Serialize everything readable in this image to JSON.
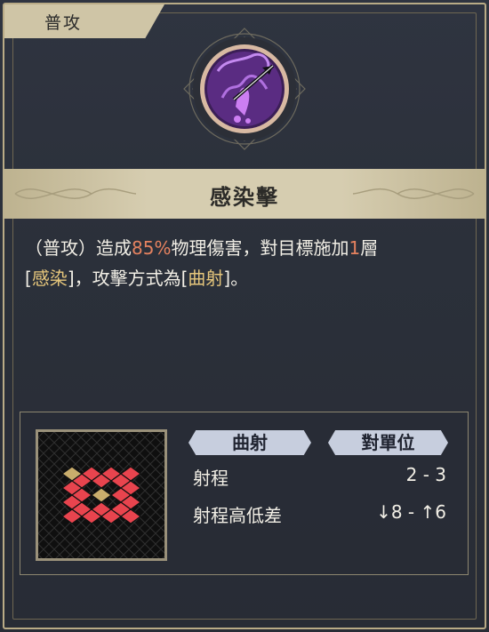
{
  "tab": {
    "label": "普攻"
  },
  "skill": {
    "name": "感染擊",
    "desc": {
      "p1": "（普攻）造成",
      "pct": "85%",
      "p2": "物理傷害，對目標施加",
      "stacks": "1",
      "p3": "層",
      "b_open": "[",
      "status": "感染",
      "p4": "]，攻擊方式為[",
      "mode": "曲射",
      "p5": "]。"
    }
  },
  "stats": {
    "attack_type": "曲射",
    "target_type": "對單位",
    "range_label": "射程",
    "range_value": "2 - 3",
    "height_label": "射程高低差",
    "height_value": "↓8 - ↑6"
  },
  "colors": {
    "highlight": "#e5825f",
    "keyword": "#e7c77c",
    "tile_red": "#e8444e",
    "tile_gold": "#c9ad6c"
  },
  "icons": {
    "skill": "poison-arrow-icon"
  }
}
